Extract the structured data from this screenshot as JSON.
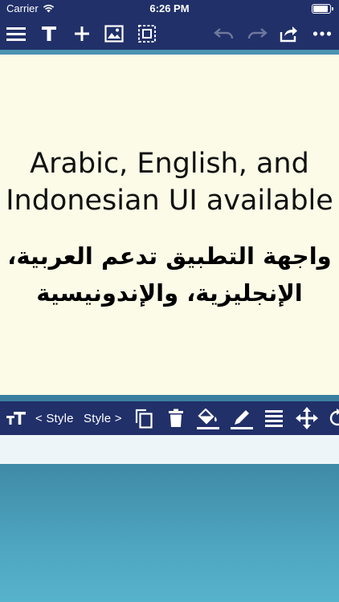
{
  "status_bar": {
    "carrier": "Carrier",
    "time": "6:26 PM",
    "battery_level": 1.0
  },
  "top_toolbar": {
    "icons": [
      "menu-icon",
      "text-icon",
      "add-icon",
      "image-icon",
      "select-all-icon",
      "undo-icon",
      "redo-icon",
      "share-icon",
      "more-icon"
    ],
    "undo_enabled": false,
    "redo_enabled": false
  },
  "canvas": {
    "english_text": "Arabic, English, and Indonesian UI available",
    "arabic_text": "واجهة التطبيق تدعم العربية، الإنجليزية، والإندونيسية"
  },
  "style_toolbar": {
    "prev_style": "< Style",
    "next_style": "Style >",
    "icons": [
      "text-size-icon",
      "copy-icon",
      "delete-icon",
      "fill-color-icon",
      "pen-color-icon",
      "align-icon",
      "move-icon",
      "rotate-icon"
    ],
    "fill_color_underline": "#ffffff",
    "pen_color_underline": "#ffffff"
  },
  "colors": {
    "toolbar_bg": "#213069",
    "canvas_bg": "#fcfbe7",
    "accent_teal": "#4a93b0"
  }
}
